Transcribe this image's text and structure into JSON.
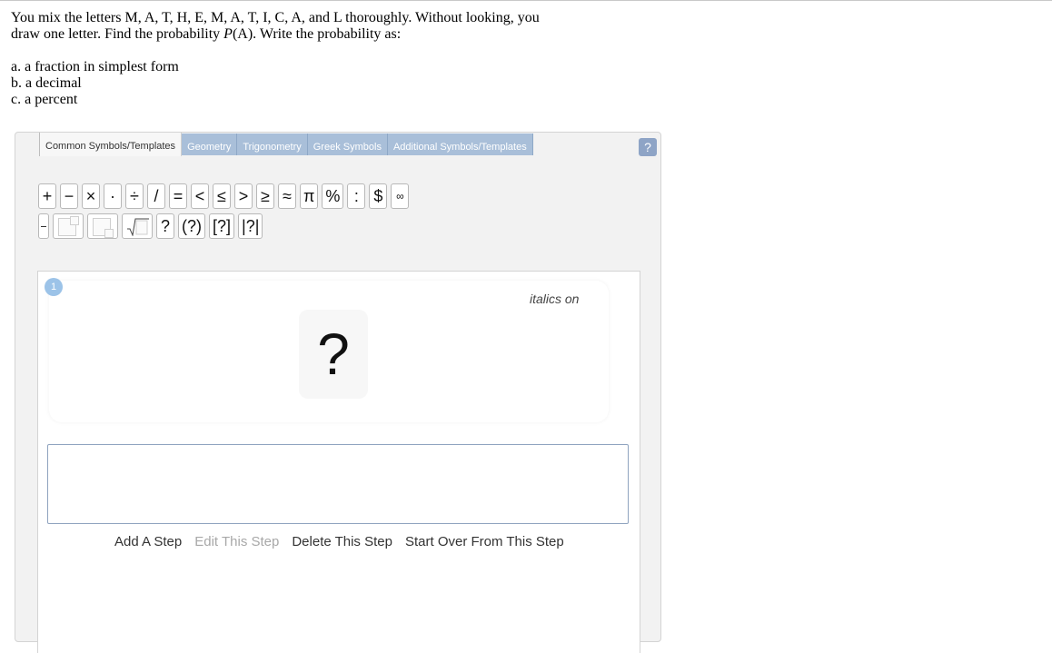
{
  "question": {
    "line1": "You mix the letters M, A, T, H, E, M, A, T, I, C, A, and L thoroughly. Without looking, you",
    "line2_pre": "draw one letter. Find the probability ",
    "line2_italic": "P",
    "line2_post": "(A). Write the probability as:",
    "option_a": "a. a fraction in simplest form",
    "option_b": "b. a decimal",
    "option_c": "c. a percent"
  },
  "tabs": [
    "Common Symbols/Templates",
    "Geometry",
    "Trigonometry",
    "Greek Symbols",
    "Additional Symbols/Templates"
  ],
  "help_label": "?",
  "symbols_row1": [
    "+",
    "−",
    "×",
    "·",
    "÷",
    "/",
    "=",
    "<",
    "≤",
    ">",
    "≥",
    "≈",
    "π",
    "%",
    ":",
    "$",
    "∞"
  ],
  "symbols_row2_text": [
    "?",
    "(?)",
    "[?]",
    "|?|"
  ],
  "step": {
    "number": "1",
    "italics_label": "italics on",
    "placeholder": "?"
  },
  "actions": {
    "add": "Add A Step",
    "edit": "Edit This Step",
    "delete": "Delete This Step",
    "start_over": "Start Over From This Step"
  }
}
